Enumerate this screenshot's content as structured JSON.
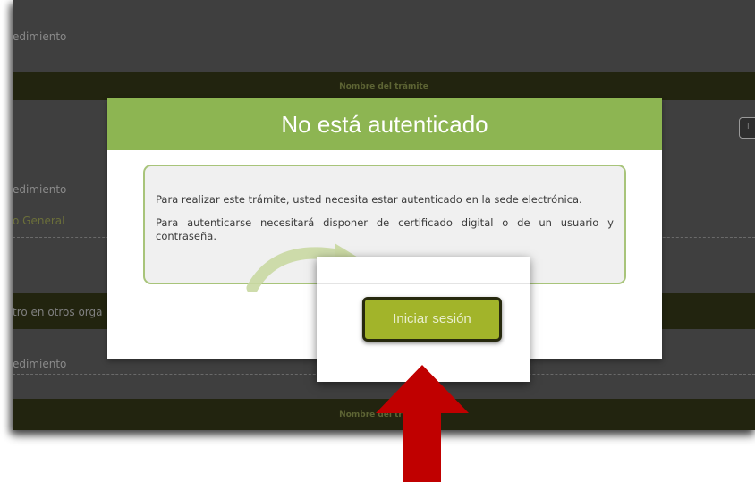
{
  "background_page": {
    "row1_label": "edimiento",
    "band1_title": "Nombre del trámite",
    "row2_label": "edimiento",
    "row3_label": "o General",
    "section_header": "tro en otros orga",
    "row4_label": "edimiento",
    "band2_title": "Nombre del trámite",
    "btn_fragment": "I"
  },
  "modal": {
    "title": "No está autenticado",
    "message_line1": "Para realizar este trámite, usted necesita estar autenticado en la sede electrónica.",
    "message_line2": "Para autenticarse necesitará disponer de certificado digital o de un usuario y contraseña.",
    "login_button_label": "Iniciar sesión"
  },
  "colors": {
    "header_green": "#8db552",
    "button_olive": "#a2b42a",
    "arrow_red": "#c00000"
  },
  "icons": [
    "curved-arrow-icon",
    "red-up-arrow-icon"
  ]
}
